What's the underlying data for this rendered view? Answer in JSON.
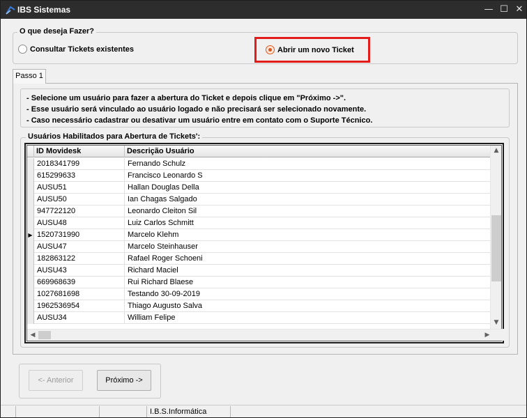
{
  "window": {
    "title": "IBS Sistemas",
    "minimize": "—",
    "maximize": "☐",
    "close": "✕"
  },
  "action_group": {
    "legend": "O que deseja Fazer?",
    "option_consult": "Consultar Tickets existentes",
    "option_new": "Abrir um novo Ticket",
    "selected": "option_new"
  },
  "tab": {
    "label": "Passo 1"
  },
  "instructions": [
    "- Selecione um usuário para fazer a abertura do Ticket e depois clique em \"Próximo ->\".",
    "- Esse usuário será vinculado ao usuário logado e não precisará ser selecionado novamente.",
    "- Caso necessário cadastrar ou desativar um usuário entre em contato com o Suporte Técnico."
  ],
  "grid": {
    "legend": "Usuários Habilitados para Abertura de Tickets':",
    "columns": [
      "ID Movidesk",
      "Descrição Usuário"
    ],
    "current_row_marker": "▶",
    "current_row_index": 6,
    "rows": [
      [
        "2018341799",
        "Fernando Schulz"
      ],
      [
        "615299633",
        "Francisco Leonardo S"
      ],
      [
        "AUSU51",
        "Hallan Douglas Della"
      ],
      [
        "AUSU50",
        "Ian Chagas Salgado"
      ],
      [
        "947722120",
        "Leonardo Cleiton Sil"
      ],
      [
        "AUSU48",
        "Luiz Carlos Schmitt"
      ],
      [
        "1520731990",
        "Marcelo Klehm"
      ],
      [
        "AUSU47",
        "Marcelo Steinhauser"
      ],
      [
        "182863122",
        "Rafael Roger Schoeni"
      ],
      [
        "AUSU43",
        "Richard Maciel"
      ],
      [
        "669968639",
        "Rui Richard Blaese"
      ],
      [
        "1027681698",
        "Testando 30-09-2019"
      ],
      [
        "1962536954",
        "Thiago Augusto Salva"
      ],
      [
        "AUSU34",
        "William Felipe"
      ]
    ]
  },
  "buttons": {
    "previous": "<- Anterior",
    "next": "Próximo ->"
  },
  "statusbar": {
    "company": "I.B.S.Informática"
  },
  "colors": {
    "highlight": "#e21b1b",
    "radio_selected": "#e0541f",
    "titlebar": "#2d2d2d"
  }
}
